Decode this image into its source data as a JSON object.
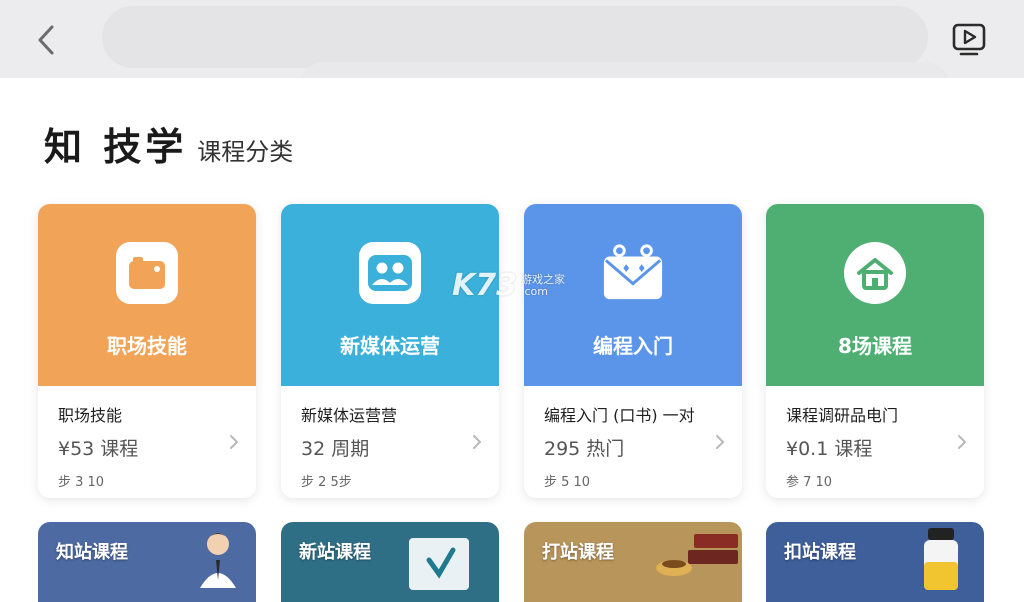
{
  "header": {
    "back_icon": "chevron-left-icon",
    "video_icon": "video-play-icon"
  },
  "title": {
    "brand": "知 技学",
    "subtitle": "课程分类"
  },
  "categories": [
    {
      "label": "职场技能",
      "icon": "camera-icon",
      "color": "#f1a357",
      "name": "职场技能",
      "meta": "¥53 课程",
      "foot": "步 3 10"
    },
    {
      "label": "新媒体运营",
      "icon": "users-icon",
      "color": "#3ab0db",
      "name": "新媒体运营营",
      "meta": "32 周期",
      "foot": "步 2 5步"
    },
    {
      "label": "编程入门",
      "icon": "envelope-icon",
      "color": "#5b95ea",
      "name": "编程入门 (口书) 一对",
      "meta": "295 热门",
      "foot": "步 5 10"
    },
    {
      "label": "8场课程",
      "icon": "home-icon",
      "color": "#4faf72",
      "name": "课程调研品电门",
      "meta": "¥0.1 课程",
      "foot": "参 7 10"
    }
  ],
  "featured": [
    {
      "label": "知站课程",
      "color": "#4d6aa3"
    },
    {
      "label": "新站课程",
      "color": "#2f6f86"
    },
    {
      "label": "打站课程",
      "color": "#b8955a"
    },
    {
      "label": "扣站课程",
      "color": "#3e5f9a"
    }
  ],
  "watermark": {
    "logo": "K73",
    "line1": "游戏之家",
    "line2": ".com"
  }
}
